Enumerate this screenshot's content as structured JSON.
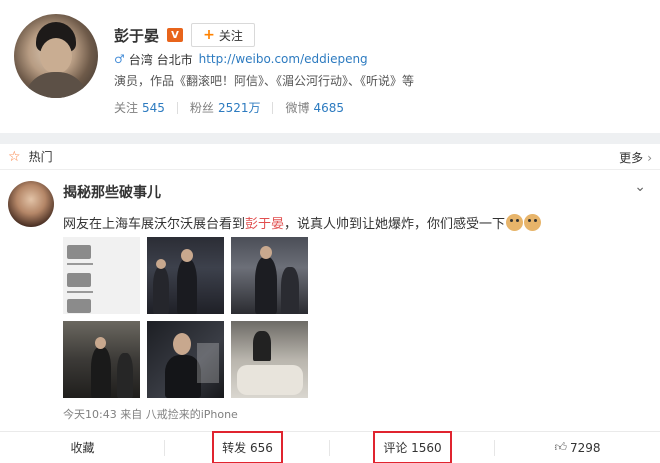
{
  "profile": {
    "name": "彭于晏",
    "verified_badge": "V",
    "follow_label": "关注",
    "location": "台湾 台北市",
    "url": "http://weibo.com/eddiepeng",
    "description": "演员，作品《翻滚吧！阿信》、《湄公河行动》、《听说》等",
    "stats": [
      {
        "label": "关注",
        "value": "545"
      },
      {
        "label": "粉丝",
        "value": "2521万"
      },
      {
        "label": "微博",
        "value": "4685"
      }
    ]
  },
  "hot": {
    "label": "热门",
    "more_label": "更多"
  },
  "post": {
    "author": "揭秘那些破事儿",
    "text_before": "网友在上海车展沃尔沃展台看到",
    "mention": "彭于晏",
    "text_after": "，说真人帅到让她爆炸，你们感受一下",
    "meta": "今天10:43 来自 八戒捡来的iPhone"
  },
  "actions": {
    "favorite": "收藏",
    "repost": "转发 656",
    "comment": "评论 1560",
    "like": "7298"
  },
  "colors": {
    "link": "#2d7bc0",
    "mention": "#e14f4f",
    "highlight_box": "#e0242f",
    "accent_orange": "#ff8200"
  }
}
